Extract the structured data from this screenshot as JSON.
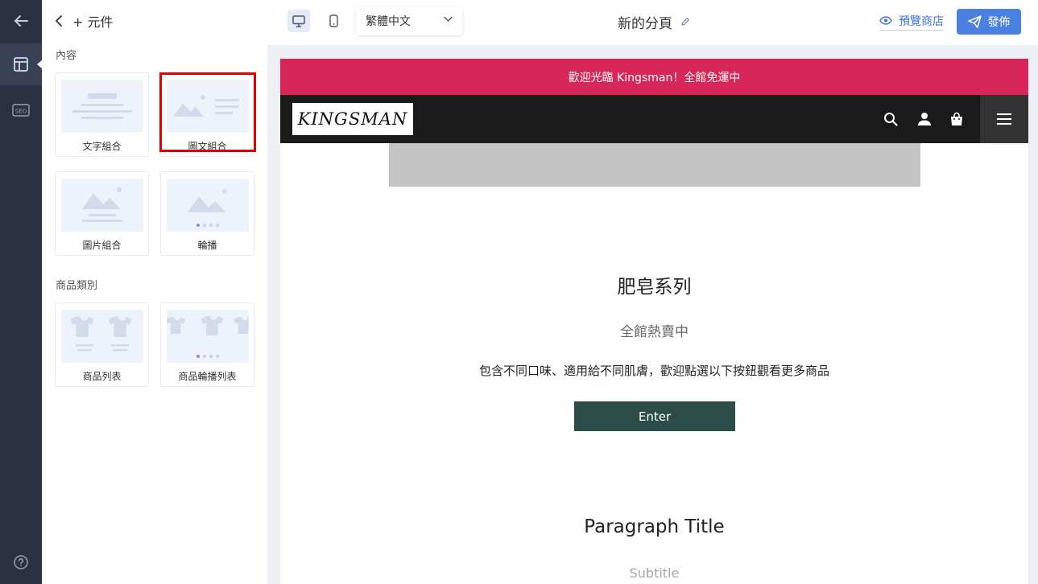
{
  "panel": {
    "title": "+ 元件",
    "sections": [
      {
        "label": "內容",
        "cards": [
          {
            "label": "文字組合"
          },
          {
            "label": "圖文組合"
          },
          {
            "label": "圖片組合"
          },
          {
            "label": "輪播"
          }
        ]
      },
      {
        "label": "商品類別",
        "cards": [
          {
            "label": "商品列表"
          },
          {
            "label": "商品輪播列表"
          }
        ]
      }
    ]
  },
  "rail": {
    "seo_label": "SEO"
  },
  "toolbar": {
    "language": "繁體中文",
    "page_title": "新的分頁",
    "preview_label": "預覽商店",
    "publish_label": "發佈"
  },
  "site": {
    "announcement": "歡迎光臨 Kingsman！全館免運中",
    "logo_text": "KINGSMAN",
    "section1": {
      "title": "肥皂系列",
      "subtitle": "全館熱賣中",
      "description": "包含不同口味、適用給不同肌膚，歡迎點選以下按鈕觀看更多商品",
      "button_label": "Enter"
    },
    "section2": {
      "title": "Paragraph Title",
      "subtitle": "Subtitle"
    }
  },
  "colors": {
    "rail": "#2b3142",
    "accent": "#4a80e0",
    "announcement": "#d8265a",
    "navbar": "#1a1a1a",
    "enter_button": "#2b4c47",
    "highlight": "#e00000"
  }
}
